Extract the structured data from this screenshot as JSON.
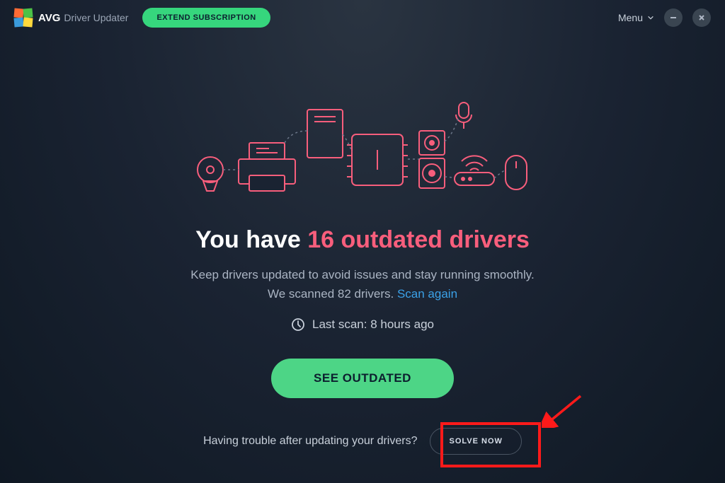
{
  "header": {
    "brand": "AVG",
    "appTitle": "Driver Updater",
    "extendBtn": "EXTEND SUBSCRIPTION",
    "menuLabel": "Menu"
  },
  "main": {
    "headingPrefix": "You have ",
    "headingHighlight": "16 outdated drivers",
    "subtitle1": "Keep drivers updated to avoid issues and stay running smoothly.",
    "subtitle2Prefix": "We scanned 82 drivers. ",
    "scanLink": "Scan again",
    "lastScan": "Last scan: 8 hours ago",
    "seeOutdatedBtn": "SEE OUTDATED"
  },
  "footer": {
    "troubleText": "Having trouble after updating your drivers?",
    "solveBtn": "SOLVE NOW"
  }
}
